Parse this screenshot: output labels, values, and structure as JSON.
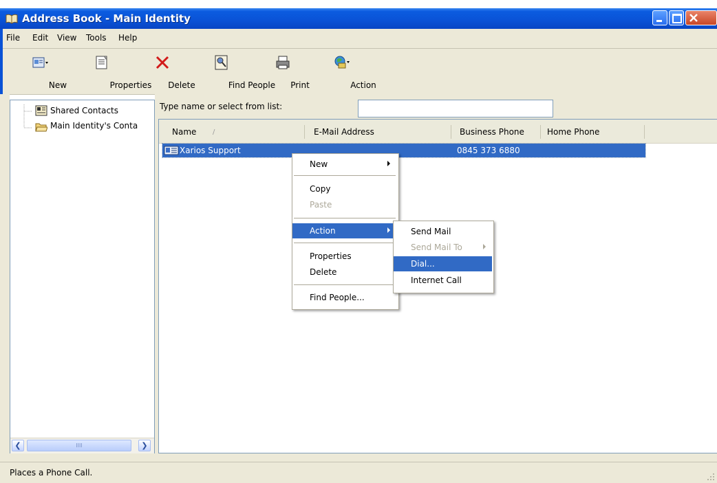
{
  "window": {
    "title": "Address Book - Main Identity"
  },
  "menubar": [
    "File",
    "Edit",
    "View",
    "Tools",
    "Help"
  ],
  "toolbar": {
    "new": "New",
    "properties": "Properties",
    "delete": "Delete",
    "find_people": "Find People",
    "print": "Print",
    "action": "Action"
  },
  "tree": {
    "items": [
      "Shared Contacts",
      "Main Identity's Conta"
    ]
  },
  "search": {
    "label": "Type name or select from list:",
    "value": ""
  },
  "list": {
    "columns": [
      "Name",
      "E-Mail Address",
      "Business Phone",
      "Home Phone"
    ],
    "sort_indicator": "/",
    "rows": [
      {
        "name": "Xarios Support",
        "email": "",
        "business_phone": "0845 373 6880",
        "home_phone": ""
      }
    ]
  },
  "context_menu": {
    "items": [
      "New",
      "Copy",
      "Paste",
      "Action",
      "Properties",
      "Delete",
      "Find People..."
    ],
    "highlighted": "Action",
    "disabled": [
      "Paste"
    ]
  },
  "action_submenu": {
    "items": [
      "Send Mail",
      "Send Mail To",
      "Dial...",
      "Internet Call"
    ],
    "highlighted": "Dial...",
    "disabled": [
      "Send Mail To"
    ]
  },
  "statusbar": {
    "text": "Places a Phone Call."
  },
  "scrollbar": {
    "grip": "IIII"
  },
  "colors": {
    "titlebar": "#0a52d6",
    "selection": "#316ac5",
    "chrome": "#ece9d8"
  }
}
